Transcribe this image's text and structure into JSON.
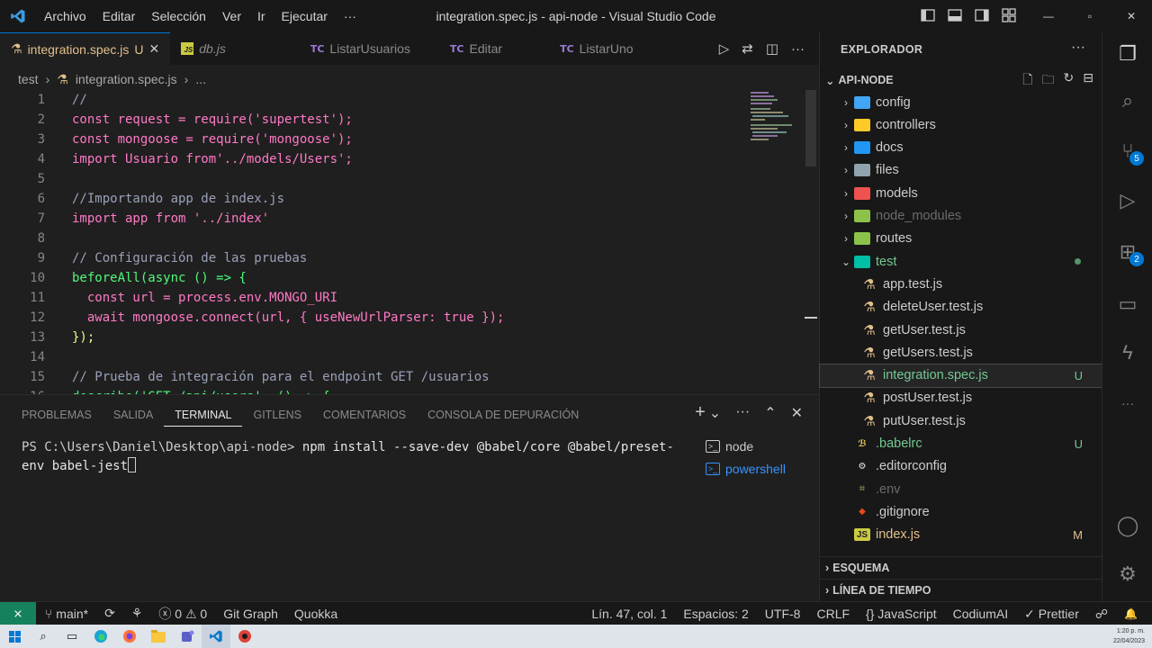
{
  "window": {
    "title": "integration.spec.js - api-node - Visual Studio Code",
    "menu": [
      "Archivo",
      "Editar",
      "Selección",
      "Ver",
      "Ir",
      "Ejecutar",
      "···"
    ],
    "controls": {
      "minimize": "—",
      "maximize": "▫",
      "close": "✕"
    }
  },
  "tabs": [
    {
      "label": "integration.spec.js",
      "status": "U",
      "active": true,
      "icon": "flask-icon"
    },
    {
      "label": "db.js",
      "icon": "js-icon"
    },
    {
      "label": "ListarUsuarios",
      "icon": "tc-icon"
    },
    {
      "label": "Editar",
      "icon": "tc-icon"
    },
    {
      "label": "ListarUno",
      "icon": "tc-icon"
    }
  ],
  "tab_icon_text": {
    "js": "JS",
    "tc": "TC"
  },
  "breadcrumb": {
    "folder": "test",
    "file": "integration.spec.js",
    "more": "..."
  },
  "code": {
    "line_numbers": [
      "1",
      "2",
      "3",
      "4",
      "5",
      "6",
      "7",
      "8",
      "9",
      "10",
      "11",
      "12",
      "13",
      "14",
      "15",
      "16"
    ],
    "lines": [
      "//",
      "const request = require('supertest');",
      "const mongoose = require('mongoose');",
      "import Usuario from'../models/Users';",
      "",
      "//Importando app de index.js",
      "import app from '../index'",
      "",
      "// Configuración de las pruebas",
      "beforeAll(async () => {",
      "  const url = process.env.MONGO_URI",
      "  await mongoose.connect(url, { useNewUrlParser: true });",
      "});",
      "",
      "// Prueba de integración para el endpoint GET /usuarios",
      "describe('GET /api/users', () => {"
    ]
  },
  "panel": {
    "tabs": [
      "PROBLEMAS",
      "SALIDA",
      "TERMINAL",
      "GITLENS",
      "COMENTARIOS",
      "CONSOLA DE DEPURACIÓN"
    ],
    "active_tab": "TERMINAL",
    "actions": {
      "add": "+",
      "split_chevron": "⌄",
      "more": "···",
      "maximize": "⌃",
      "close": "✕"
    },
    "terminal_prompt": "PS C:\\Users\\Daniel\\Desktop\\api-node> ",
    "terminal_command": "npm install --save-dev @babel/core @babel/preset-env babel-jest",
    "terminals": [
      {
        "label": "node",
        "active": false
      },
      {
        "label": "powershell",
        "active": true
      }
    ],
    "terminal_icon": ">_"
  },
  "explorer": {
    "title": "EXPLORADOR",
    "more": "···",
    "project": "API-NODE",
    "project_actions": [
      "new-file-icon",
      "new-folder-icon",
      "refresh-icon",
      "collapse-icon"
    ],
    "items": [
      {
        "label": "config",
        "type": "folder",
        "color": "#42a5f5",
        "status": ""
      },
      {
        "label": "controllers",
        "type": "folder",
        "color": "#ffca28",
        "status": ""
      },
      {
        "label": "docs",
        "type": "folder",
        "color": "#2196f3",
        "status": ""
      },
      {
        "label": "files",
        "type": "folder",
        "color": "#90a4ae",
        "status": ""
      },
      {
        "label": "models",
        "type": "folder",
        "color": "#ef5350",
        "status": ""
      },
      {
        "label": "node_modules",
        "type": "folder",
        "color": "#8bc34a",
        "status": "",
        "dim": true
      },
      {
        "label": "routes",
        "type": "folder",
        "color": "#8bc34a",
        "status": ""
      },
      {
        "label": "test",
        "type": "folder-open",
        "color": "#00bfa5",
        "status": "dot"
      },
      {
        "label": "app.test.js",
        "type": "test",
        "status": ""
      },
      {
        "label": "deleteUser.test.js",
        "type": "test",
        "status": ""
      },
      {
        "label": "getUser.test.js",
        "type": "test",
        "status": ""
      },
      {
        "label": "getUsers.test.js",
        "type": "test",
        "status": ""
      },
      {
        "label": "integration.spec.js",
        "type": "test",
        "status": "U",
        "selected": true
      },
      {
        "label": "postUser.test.js",
        "type": "test",
        "status": ""
      },
      {
        "label": "putUser.test.js",
        "type": "test",
        "status": ""
      },
      {
        "label": ".babelrc",
        "type": "babel",
        "status": "U"
      },
      {
        "label": ".editorconfig",
        "type": "editorconfig",
        "status": ""
      },
      {
        "label": ".env",
        "type": "env",
        "status": "",
        "dim": true
      },
      {
        "label": ".gitignore",
        "type": "git",
        "status": ""
      },
      {
        "label": "index.js",
        "type": "js",
        "status": "M"
      }
    ],
    "sections": [
      "ESQUEMA",
      "LÍNEA DE TIEMPO"
    ]
  },
  "activity": {
    "items": [
      {
        "name": "explorer-icon",
        "glyph": "❐",
        "active": true
      },
      {
        "name": "search-icon",
        "glyph": "⌕"
      },
      {
        "name": "source-control-icon",
        "glyph": "⑂",
        "badge": "5"
      },
      {
        "name": "run-debug-icon",
        "glyph": "▷"
      },
      {
        "name": "extensions-icon",
        "glyph": "⊞",
        "badge": "2"
      },
      {
        "name": "remote-explorer-icon",
        "glyph": "▭"
      },
      {
        "name": "thunder-client-icon",
        "glyph": "ϟ"
      },
      {
        "name": "more-icon",
        "glyph": "···"
      }
    ],
    "bottom": [
      {
        "name": "account-icon",
        "glyph": "◯"
      },
      {
        "name": "manage-gear-icon",
        "glyph": "⚙"
      }
    ]
  },
  "statusbar": {
    "remote": "⨯",
    "branch": "main*",
    "sync": "⟳",
    "problems_errors": "0",
    "problems_warnings": "0",
    "git_graph": "Git Graph",
    "quokka": "Quokka",
    "position": "Lín. 47, col. 1",
    "spaces": "Espacios: 2",
    "encoding": "UTF-8",
    "eol": "CRLF",
    "language": "JavaScript",
    "codium": "CodiumAI",
    "prettier": "✓ Prettier",
    "feedback": "☍",
    "bell": "🔔"
  },
  "taskbar": {
    "time": "1:20 p. m.",
    "date": "22/04/2023",
    "apps": [
      "windows-start-icon",
      "search-icon",
      "task-view-icon",
      "edge-icon",
      "firefox-icon",
      "file-explorer-icon",
      "teams-icon",
      "vscode-icon",
      "chrome-icon"
    ]
  }
}
